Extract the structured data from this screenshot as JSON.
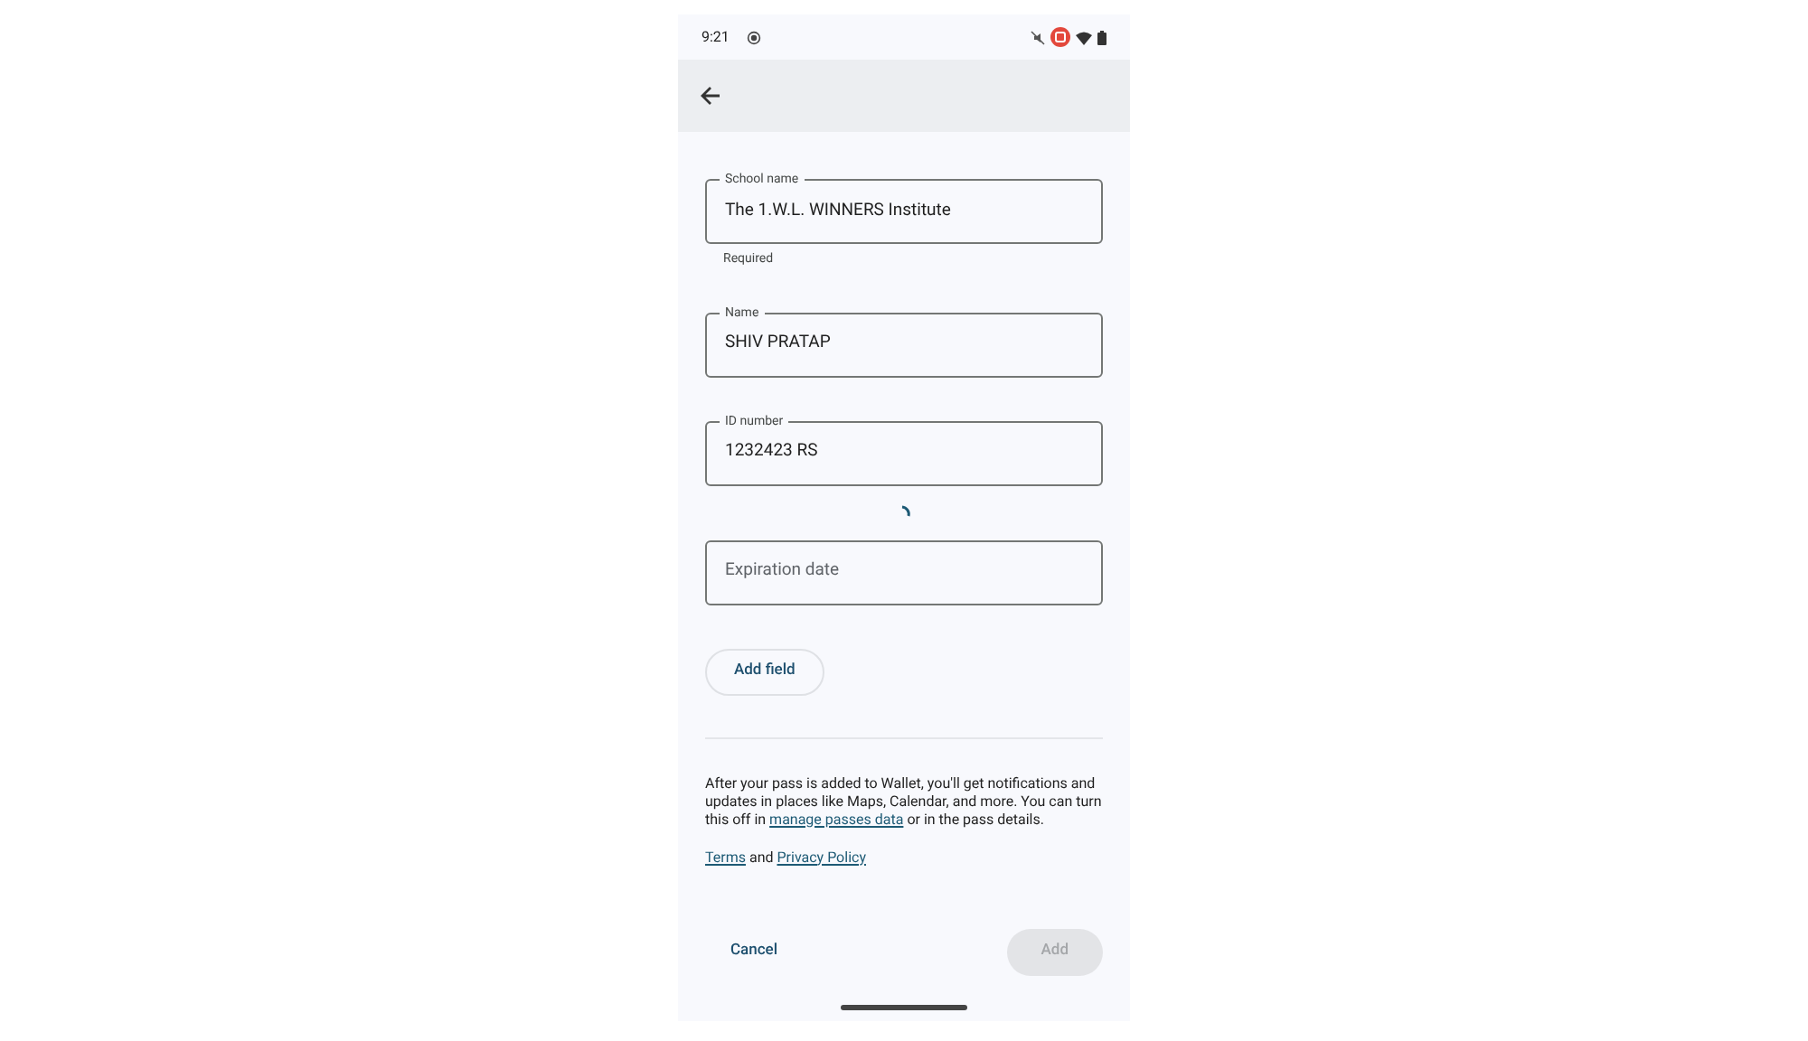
{
  "status_bar": {
    "time": "9:21"
  },
  "fields": [
    {
      "label": "School name",
      "value": "The 1.W.L. WINNERS Institute",
      "helper": "Required"
    },
    {
      "label": "Name",
      "value": "SHIV PRATAP"
    },
    {
      "label": "ID number",
      "value": "1232423 RS"
    },
    {
      "placeholder": "Expiration date",
      "loading": true
    }
  ],
  "add_field_button": "Add field",
  "notice": [
    {
      "kind": "text",
      "text": "After your pass is added to Wallet, you'll get notifications and updates in places like Maps, Calendar, and more. You can turn this off in "
    },
    {
      "kind": "link",
      "text": "manage passes data"
    },
    {
      "kind": "text",
      "text": " or in the pass details."
    }
  ],
  "legal": [
    {
      "kind": "link",
      "text": "Terms"
    },
    {
      "kind": "text",
      "text": " and "
    },
    {
      "kind": "link",
      "text": "Privacy Policy"
    }
  ],
  "actions": [
    {
      "label": "Cancel",
      "kind": "text",
      "disabled": false
    },
    {
      "label": "Add",
      "kind": "filled",
      "disabled": true
    }
  ]
}
